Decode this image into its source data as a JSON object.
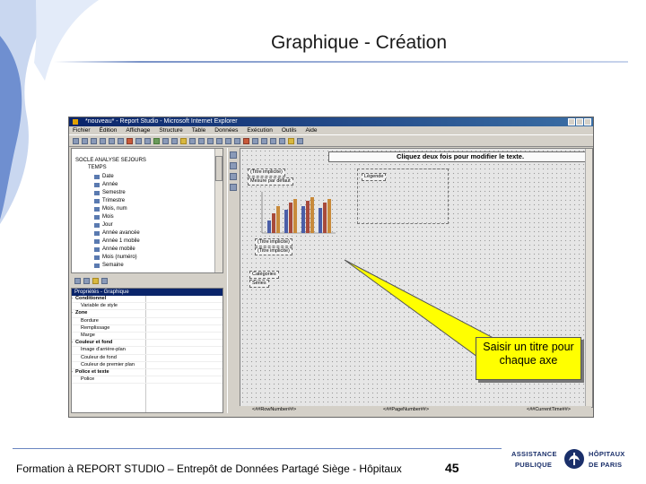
{
  "slide": {
    "title": "Graphique - Création",
    "footer_text": "Formation à REPORT STUDIO – Entrepôt de Données Partagé Siège - Hôpitaux",
    "page_number": "45",
    "callout_text": "Saisir un titre pour chaque axe"
  },
  "logo": {
    "line1": "ASSISTANCE",
    "line2": "PUBLIQUE",
    "line3": "HÔPITAUX",
    "line4": "DE PARIS"
  },
  "app": {
    "window_title": "*nouveau* - Report Studio - Microsoft Internet Explorer",
    "menu": [
      "Fichier",
      "Édition",
      "Affichage",
      "Structure",
      "Table",
      "Données",
      "Exécution",
      "Outils",
      "Aide"
    ],
    "tree": {
      "root": "SOCLE ANALYSE SEJOURS",
      "folder": "TEMPS",
      "items": [
        "Date",
        "Année",
        "Semestre",
        "Trimestre",
        "Mois, num",
        "Mois",
        "Jour",
        "Année avancée",
        "Année 1 mobile",
        "Année mobile",
        "Mois (numéro)",
        "Semaine"
      ]
    },
    "properties": {
      "header": "Propriétés - Graphique",
      "rows": [
        {
          "label": "Conditionnel",
          "group": true
        },
        {
          "label": "Variable de style",
          "group": false
        },
        {
          "label": "Zone",
          "group": true
        },
        {
          "label": "Bordure",
          "group": false
        },
        {
          "label": "Remplissage",
          "group": false
        },
        {
          "label": "Marge",
          "group": false
        },
        {
          "label": "Couleur et fond",
          "group": true
        },
        {
          "label": "Image d'arrière-plan",
          "group": false
        },
        {
          "label": "Couleur de fond",
          "group": false
        },
        {
          "label": "Couleur de premier plan",
          "group": false
        },
        {
          "label": "Police et texte",
          "group": true
        },
        {
          "label": "Police",
          "group": false
        }
      ]
    },
    "canvas": {
      "title_placeholder": "Cliquez deux fois pour modifier le texte.",
      "axis_title_y": "(Titre implicite)",
      "axis_title_x": "(Titre implicite)",
      "axis_label_top": "(Titre implicite)",
      "legend_label": "Légende",
      "category_box": "Catégories",
      "series_box": "Séries",
      "value_box": "Mesure par défaut",
      "status_left": "<##RowNumber##>",
      "status_mid": "<##PageNumber##>",
      "status_right": "<##CurrentTime##>"
    }
  }
}
